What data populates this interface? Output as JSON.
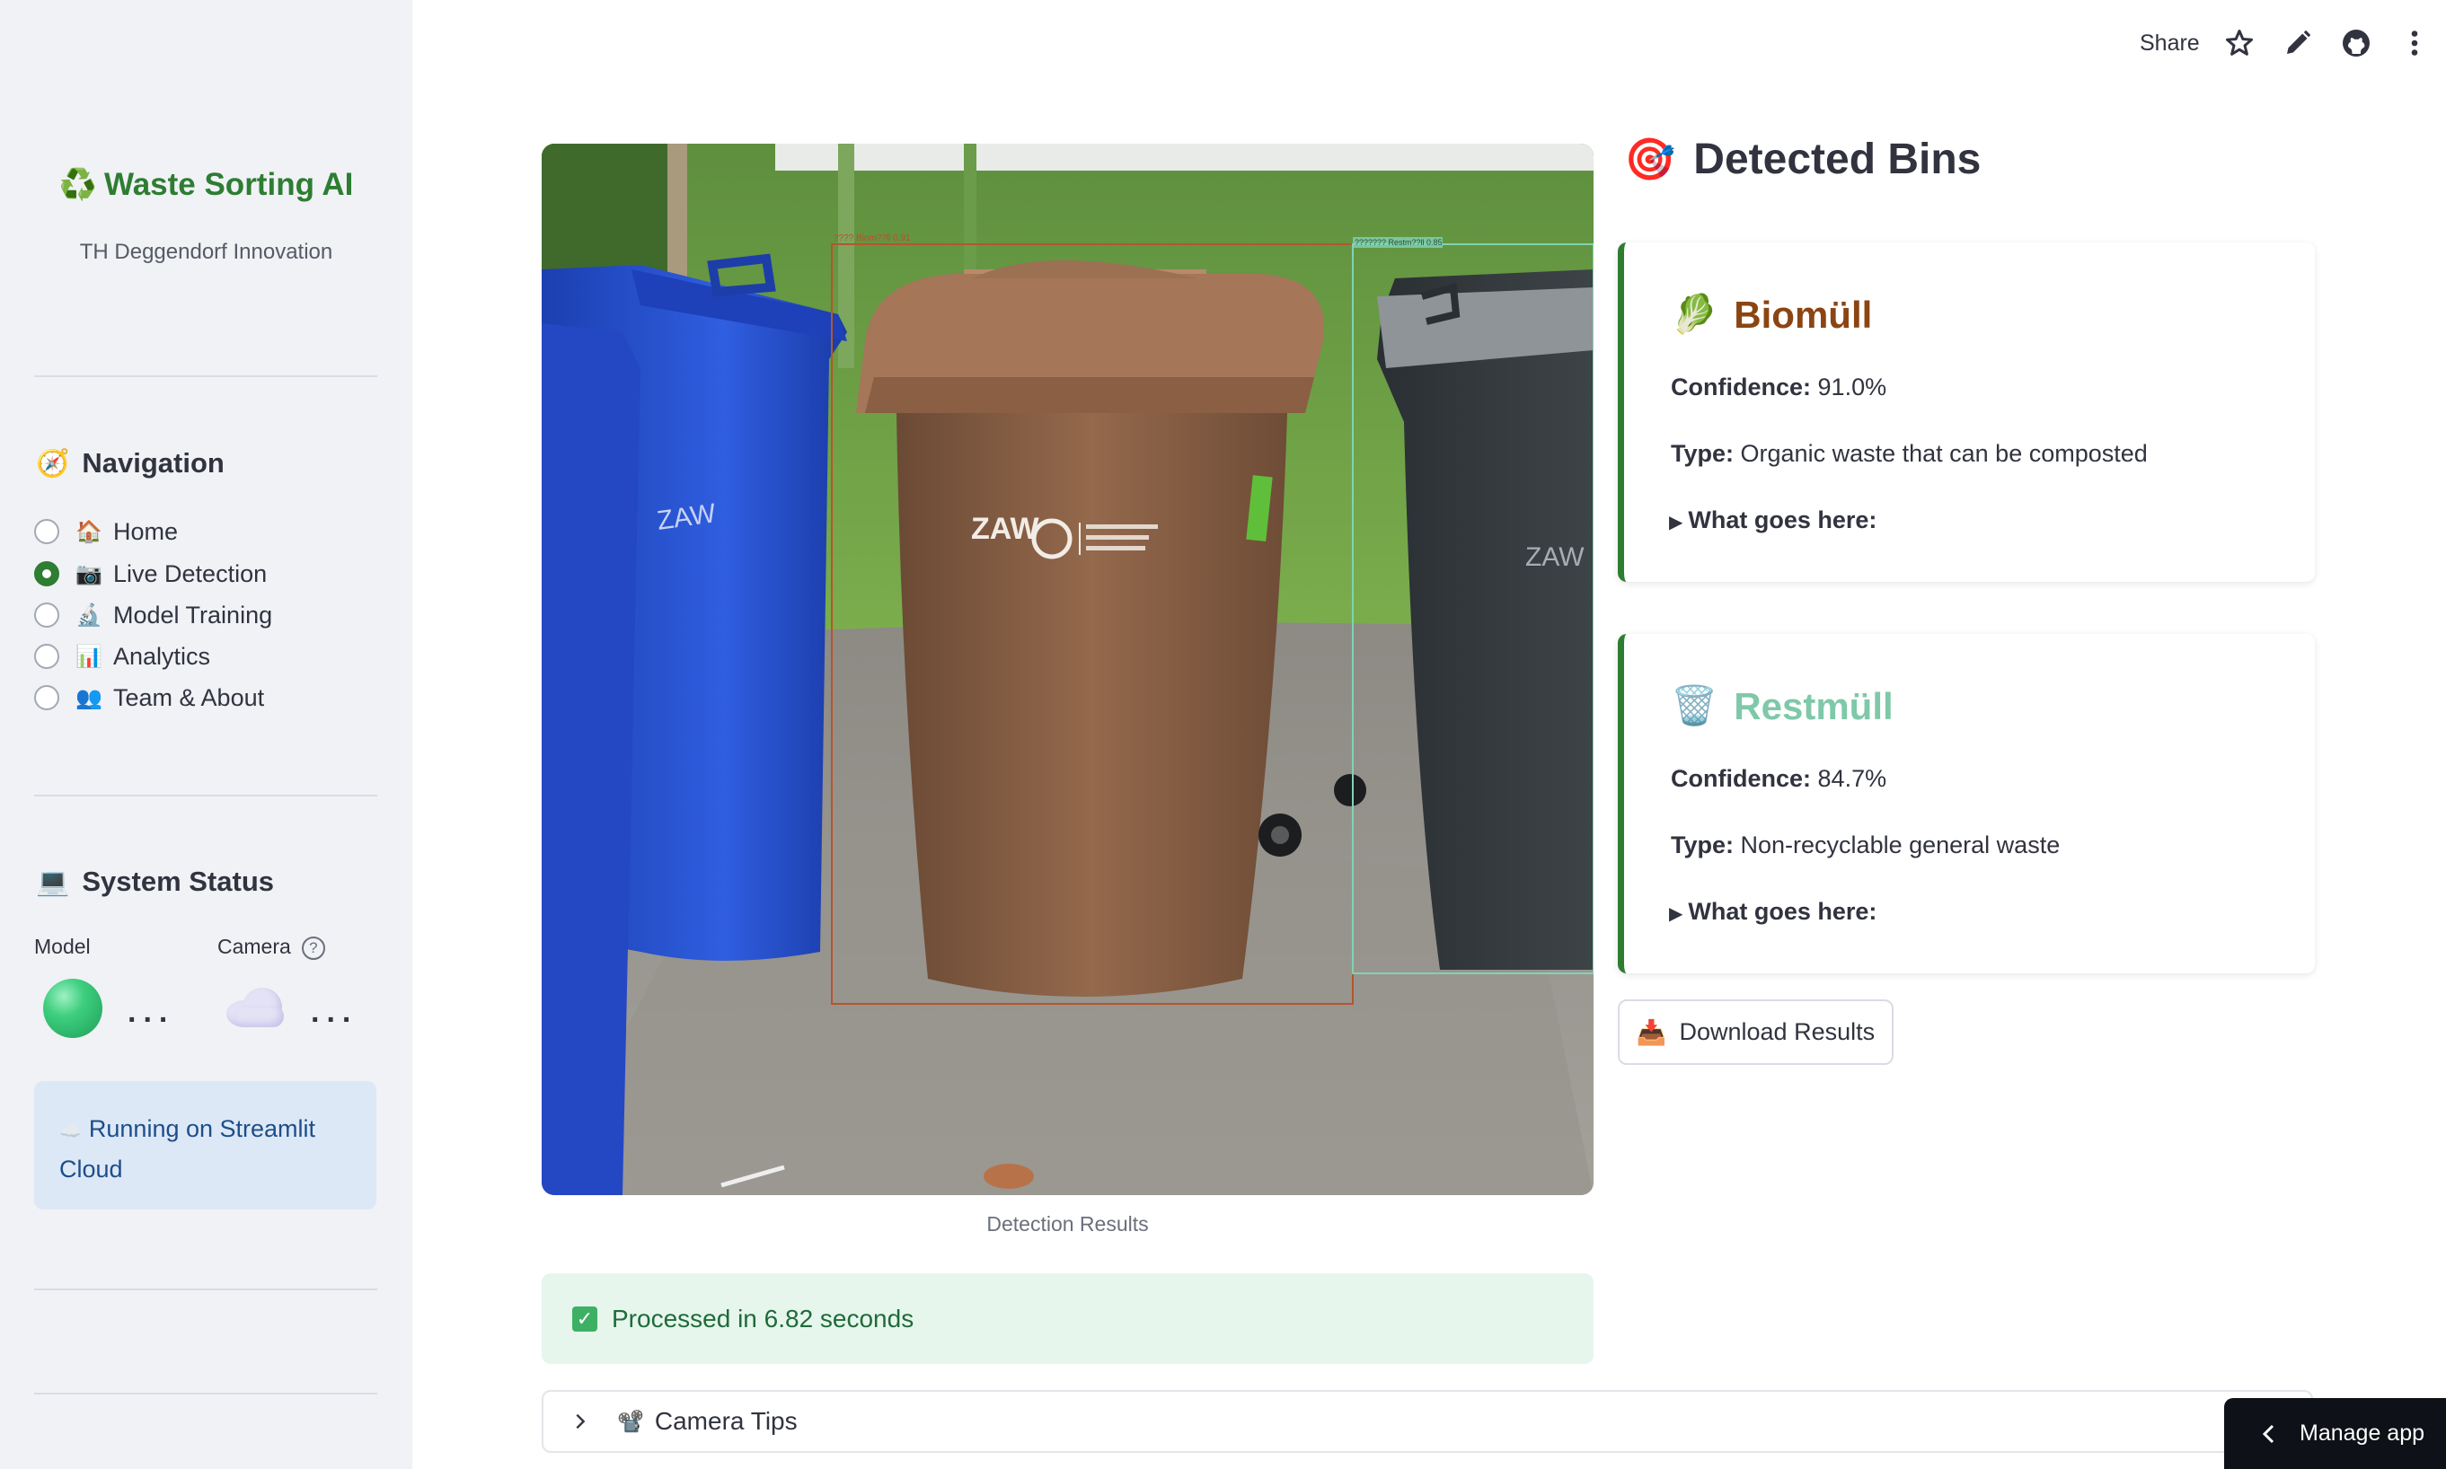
{
  "header": {
    "share_label": "Share",
    "icons": [
      "star-icon",
      "pencil-icon",
      "github-icon",
      "more-vertical-icon"
    ]
  },
  "sidebar": {
    "brand_icon": "♻️",
    "brand": "Waste Sorting AI",
    "subtitle": "TH Deggendorf Innovation",
    "navigation": {
      "icon": "🧭",
      "title": "Navigation",
      "items": [
        {
          "icon": "🏠",
          "label": "Home",
          "selected": false
        },
        {
          "icon": "📷",
          "label": "Live Detection",
          "selected": true
        },
        {
          "icon": "🔬",
          "label": "Model Training",
          "selected": false
        },
        {
          "icon": "📊",
          "label": "Analytics",
          "selected": false
        },
        {
          "icon": "👥",
          "label": "Team & About",
          "selected": false
        }
      ]
    },
    "system_status": {
      "icon": "💻",
      "title": "System Status",
      "model_label": "Model",
      "camera_label": "Camera",
      "model_value": "...",
      "camera_value": "..."
    },
    "info": {
      "icon": "☁️",
      "text": "Running on Streamlit Cloud"
    }
  },
  "main": {
    "image_caption": "Detection Results",
    "detections_overlay": [
      {
        "label": "???? Biom??ll 0.91",
        "color": "#b5562a"
      },
      {
        "label": "??????? Restm??ll 0.85",
        "color": "#7fd3b4"
      }
    ],
    "success_message": "Processed in 6.82 seconds",
    "expander_icon": "📽️",
    "expander_label": "Camera Tips"
  },
  "results": {
    "title_icon": "🎯",
    "title": "Detected Bins",
    "cards": [
      {
        "icon": "🥬",
        "name": "Biomüll",
        "name_color": "#8b4513",
        "confidence_label": "Confidence:",
        "confidence": "91.0%",
        "type_label": "Type:",
        "type": "Organic waste that can be composted",
        "what_goes_here": "What goes here:"
      },
      {
        "icon": "🗑️",
        "name": "Restmüll",
        "name_color": "#7fc8a9",
        "confidence_label": "Confidence:",
        "confidence": "84.7%",
        "type_label": "Type:",
        "type": "Non-recyclable general waste",
        "what_goes_here": "What goes here:"
      }
    ],
    "download_icon": "📥",
    "download_label": "Download Results"
  },
  "manage_app": "Manage app",
  "colors": {
    "accent": "#2e7d32",
    "sidebar_bg": "#f0f2f6",
    "success_bg": "#e6f6ec",
    "info_bg": "#dde8f6"
  }
}
